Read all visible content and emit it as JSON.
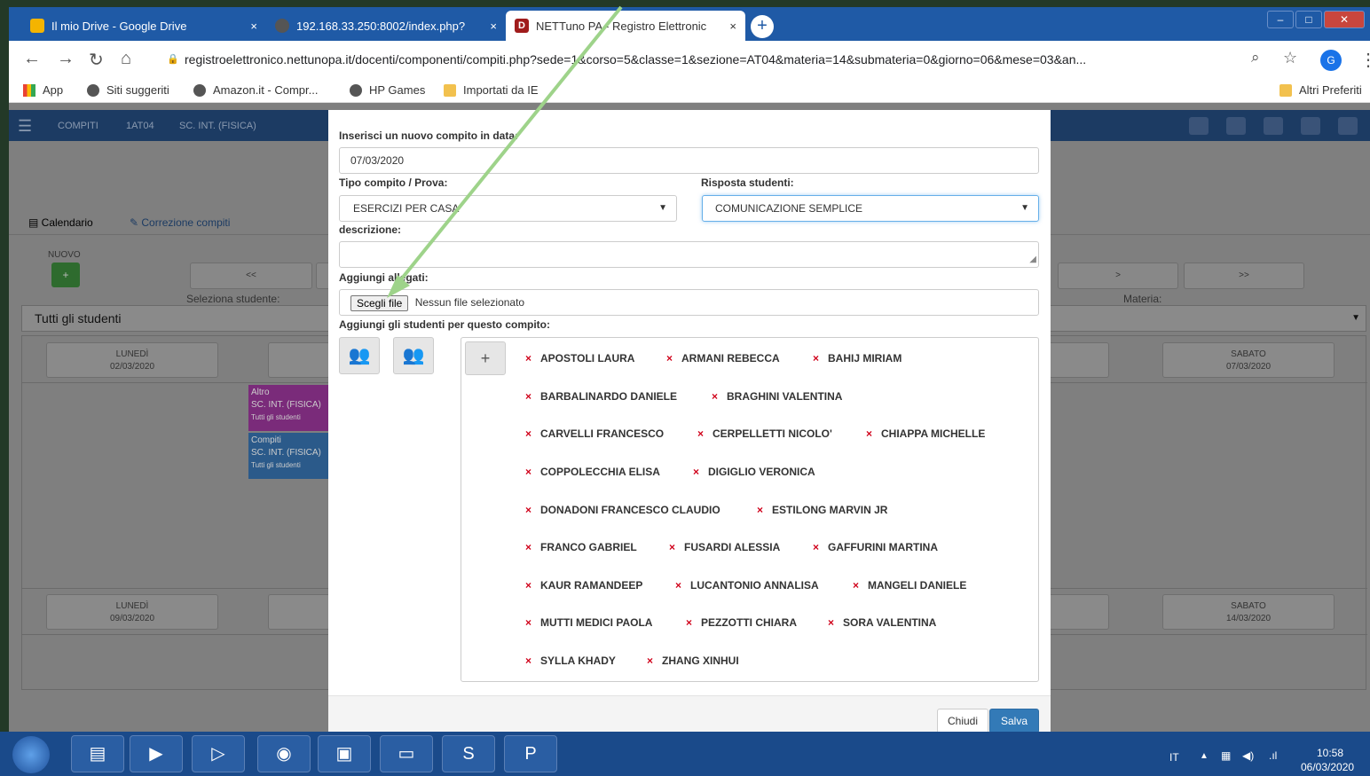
{
  "browser": {
    "tabs": [
      {
        "title": "Il mio Drive - Google Drive",
        "close": "×"
      },
      {
        "title": "192.168.33.250:8002/index.php?",
        "close": "×"
      },
      {
        "title": "NETTuno PA - Registro Elettronic",
        "close": "×"
      }
    ],
    "new_tab": "+",
    "url": "registroelettronico.nettunopa.it/docenti/componenti/compiti.php?sede=1&corso=5&classe=1&sezione=AT04&materia=14&submateria=0&giorno=06&mese=03&an...",
    "bookmarks": [
      "App",
      "Siti suggeriti",
      "Amazon.it - Compr...",
      "HP Games",
      "Importati da IE"
    ],
    "other_bookmarks": "Altri Preferiti",
    "avatar": "G"
  },
  "app_nav": {
    "items": [
      "COMPITI",
      "1AT04",
      "SC. INT. (FISICA)"
    ]
  },
  "page": {
    "tab_calendar": "Calendario",
    "tab_correction": "Correzione compiti",
    "new_label": "NUOVO",
    "new_button": "+",
    "prev_week": "<<",
    "next_day": ">",
    "next_week": ">>",
    "select_student_label": "Seleziona studente:",
    "subject_label": "Materia:",
    "student_select_value": "Tutti gli studenti",
    "days": [
      {
        "name": "LUNEDÌ",
        "date": "02/03/2020"
      },
      {
        "name": "SABATO",
        "date": "07/03/2020"
      },
      {
        "name": "LUNEDÌ",
        "date": "09/03/2020"
      },
      {
        "name": "SABATO",
        "date": "14/03/2020"
      }
    ],
    "events": [
      {
        "type": "Altro",
        "subject": "SC. INT. (FISICA)",
        "who": "Tutti gli studenti",
        "color": "#7a2b7a"
      },
      {
        "type": "Compiti",
        "subject": "SC. INT. (FISICA)",
        "who": "Tutti gli studenti",
        "color": "#2b5a8a"
      }
    ]
  },
  "modal": {
    "date_label": "Inserisci un nuovo compito in data:",
    "date_value": "07/03/2020",
    "type_label": "Tipo compito / Prova:",
    "type_value": "ESERCIZI PER CASA",
    "response_label": "Risposta studenti:",
    "response_value": "COMUNICAZIONE SEMPLICE",
    "description_label": "descrizione:",
    "attachments_label": "Aggiungi allegati:",
    "choose_file": "Scegli file",
    "no_file": "Nessun file selezionato",
    "students_label": "Aggiungi gli studenti per questo compito:",
    "add_button": "+",
    "students": [
      "APOSTOLI LAURA",
      "ARMANI REBECCA",
      "BAHIJ MIRIAM",
      "BARBALINARDO DANIELE",
      "BRAGHINI VALENTINA",
      "CARVELLI FRANCESCO",
      "CERPELLETTI NICOLO'",
      "CHIAPPA MICHELLE",
      "COPPOLECCHIA ELISA",
      "DIGIGLIO VERONICA",
      "DONADONI FRANCESCO CLAUDIO",
      "ESTILONG MARVIN JR",
      "FRANCO GABRIEL",
      "FUSARDI ALESSIA",
      "GAFFURINI MARTINA",
      "KAUR RAMANDEEP",
      "LUCANTONIO ANNALISA",
      "MANGELI DANIELE",
      "MUTTI MEDICI PAOLA",
      "PEZZOTTI CHIARA",
      "SORA VALENTINA",
      "SYLLA KHADY",
      "ZHANG XINHUI"
    ],
    "remove_mark": "×",
    "close_button": "Chiudi",
    "save_button": "Salva"
  },
  "taskbar": {
    "lang": "IT",
    "time": "10:58",
    "date": "06/03/2020"
  },
  "colors": {
    "arrow": "#9ed38a",
    "primary": "#337ab7",
    "remove": "#d0021b"
  }
}
